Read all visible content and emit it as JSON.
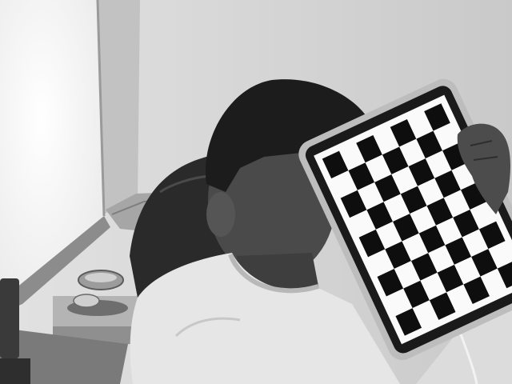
{
  "scene": {
    "palette": {
      "wall": "#d6d6d6",
      "window": "#f7f7f7",
      "chair": "#2a2a2a",
      "hair": "#1c1c1c",
      "skin": "#4a4a4a",
      "shirt": "#e6e6e6",
      "tablet_frame": "#bdbdbd",
      "tablet_bezel": "#1a1a1a",
      "board_dark": "#0e0e0e",
      "board_light": "#fafafa"
    },
    "checkerboard": {
      "rows": 9,
      "cols": 7
    }
  }
}
